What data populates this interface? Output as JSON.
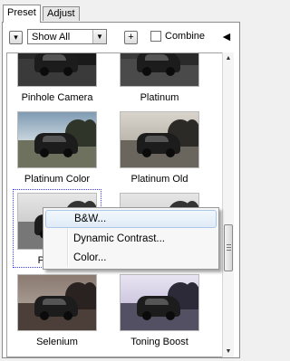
{
  "tabs": [
    {
      "label": "Preset"
    },
    {
      "label": "Adjust"
    }
  ],
  "toolbar": {
    "menu_arrow": "▾",
    "filter_value": "Show All",
    "add_label": "+",
    "combine_label": "Combine",
    "combine_checked": false,
    "back_arrow": "◄"
  },
  "presets": [
    {
      "label": "Pinhole Camera",
      "tone": "bw-vignette"
    },
    {
      "label": "Platinum",
      "tone": "platinum"
    },
    {
      "label": "Platinum Color",
      "tone": "color-muted"
    },
    {
      "label": "Platinum Old",
      "tone": "platinum-old"
    },
    {
      "label": "Platinum",
      "tone": "bw",
      "selected": true
    },
    {
      "label": "",
      "tone": "bw"
    },
    {
      "label": "Selenium",
      "tone": "selenium"
    },
    {
      "label": "Toning Boost",
      "tone": "toning-boost"
    }
  ],
  "context_menu": {
    "items": [
      {
        "label": "B&W..."
      },
      {
        "label": "Dynamic Contrast..."
      },
      {
        "label": "Color..."
      }
    ]
  },
  "scrollbar": {
    "up": "▲",
    "down": "▼"
  }
}
